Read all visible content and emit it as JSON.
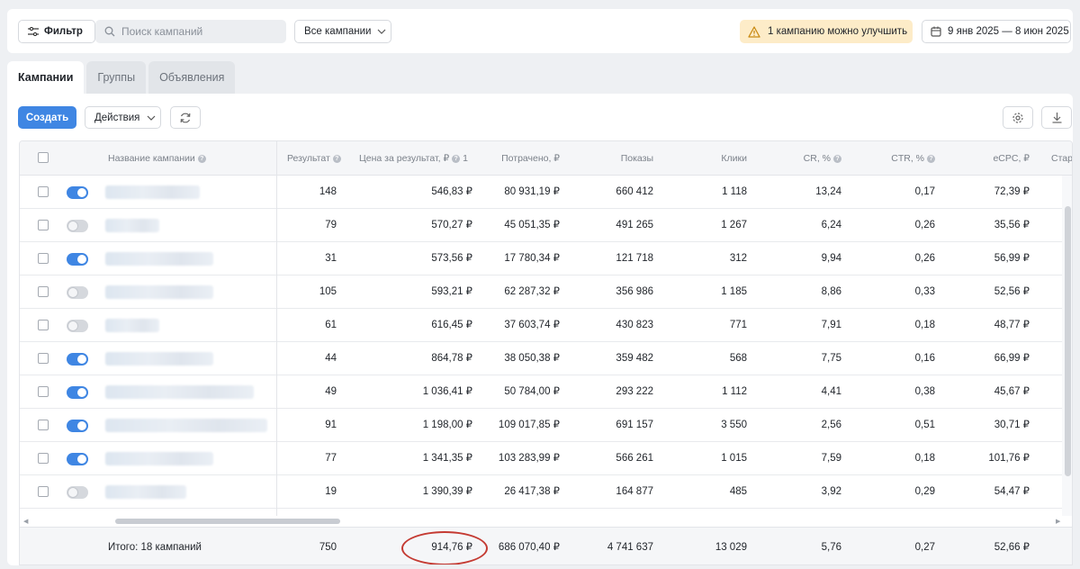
{
  "toolbar": {
    "filter_label": "Фильтр",
    "search_placeholder": "Поиск кампаний",
    "campaigns_select": "Все кампании",
    "improve_notice": "1 кампанию можно улучшить",
    "date_range": "9 янв 2025 — 8 июн 2025"
  },
  "tabs": [
    {
      "label": "Кампании",
      "active": true
    },
    {
      "label": "Группы",
      "active": false
    },
    {
      "label": "Объявления",
      "active": false
    }
  ],
  "actions": {
    "create_label": "Создать",
    "actions_label": "Действия"
  },
  "table": {
    "columns": {
      "name": "Название кампании",
      "result": "Результат",
      "cost_per_result": "Цена за результат, ₽",
      "cost_per_result_suffix": "1",
      "spent": "Потрачено, ₽",
      "impressions": "Показы",
      "clicks": "Клики",
      "cr": "CR, %",
      "ctr": "CTR, %",
      "ecpc": "eCPC, ₽",
      "start": "Старт"
    },
    "rows": [
      {
        "enabled": true,
        "result": "148",
        "cost": "546,83 ₽",
        "spent": "80 931,19 ₽",
        "impressions": "660 412",
        "clicks": "1 118",
        "cr": "13,24",
        "ctr": "0,17",
        "ecpc": "72,39 ₽"
      },
      {
        "enabled": false,
        "result": "79",
        "cost": "570,27 ₽",
        "spent": "45 051,35 ₽",
        "impressions": "491 265",
        "clicks": "1 267",
        "cr": "6,24",
        "ctr": "0,26",
        "ecpc": "35,56 ₽"
      },
      {
        "enabled": true,
        "result": "31",
        "cost": "573,56 ₽",
        "spent": "17 780,34 ₽",
        "impressions": "121 718",
        "clicks": "312",
        "cr": "9,94",
        "ctr": "0,26",
        "ecpc": "56,99 ₽"
      },
      {
        "enabled": false,
        "result": "105",
        "cost": "593,21 ₽",
        "spent": "62 287,32 ₽",
        "impressions": "356 986",
        "clicks": "1 185",
        "cr": "8,86",
        "ctr": "0,33",
        "ecpc": "52,56 ₽"
      },
      {
        "enabled": false,
        "result": "61",
        "cost": "616,45 ₽",
        "spent": "37 603,74 ₽",
        "impressions": "430 823",
        "clicks": "771",
        "cr": "7,91",
        "ctr": "0,18",
        "ecpc": "48,77 ₽"
      },
      {
        "enabled": true,
        "result": "44",
        "cost": "864,78 ₽",
        "spent": "38 050,38 ₽",
        "impressions": "359 482",
        "clicks": "568",
        "cr": "7,75",
        "ctr": "0,16",
        "ecpc": "66,99 ₽"
      },
      {
        "enabled": true,
        "result": "49",
        "cost": "1 036,41 ₽",
        "spent": "50 784,00 ₽",
        "impressions": "293 222",
        "clicks": "1 112",
        "cr": "4,41",
        "ctr": "0,38",
        "ecpc": "45,67 ₽"
      },
      {
        "enabled": true,
        "result": "91",
        "cost": "1 198,00 ₽",
        "spent": "109 017,85 ₽",
        "impressions": "691 157",
        "clicks": "3 550",
        "cr": "2,56",
        "ctr": "0,51",
        "ecpc": "30,71 ₽"
      },
      {
        "enabled": true,
        "result": "77",
        "cost": "1 341,35 ₽",
        "spent": "103 283,99 ₽",
        "impressions": "566 261",
        "clicks": "1 015",
        "cr": "7,59",
        "ctr": "0,18",
        "ecpc": "101,76 ₽"
      },
      {
        "enabled": false,
        "result": "19",
        "cost": "1 390,39 ₽",
        "spent": "26 417,38 ₽",
        "impressions": "164 877",
        "clicks": "485",
        "cr": "3,92",
        "ctr": "0,29",
        "ecpc": "54,47 ₽"
      }
    ],
    "totals": {
      "label": "Итого: 18 кампаний",
      "result": "750",
      "cost": "914,76 ₽",
      "spent": "686 070,40 ₽",
      "impressions": "4 741 637",
      "clicks": "13 029",
      "cr": "5,76",
      "ctr": "0,27",
      "ecpc": "52,66 ₽"
    }
  },
  "colors": {
    "accent": "#3f86e3",
    "notice_bg": "#fdecc8",
    "highlight_circle": "#c43a32"
  }
}
